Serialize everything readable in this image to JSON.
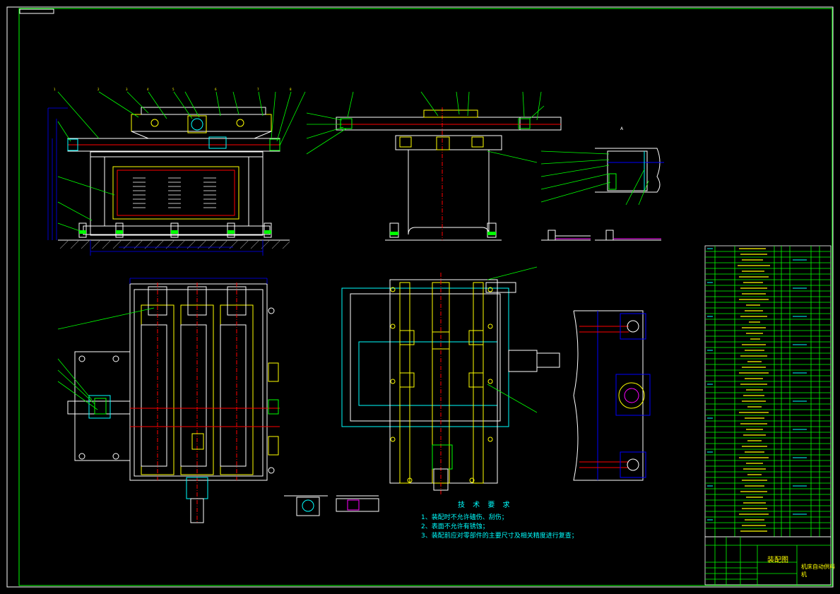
{
  "drawing": {
    "technical_requirements": {
      "title": "技 术 要 求",
      "lines": [
        "1、装配时不允许磕伤、刮伤；",
        "2、表面不允许有锈蚀；",
        "3、装配前应对零部件的主要尺寸及相关精度进行复查；"
      ]
    },
    "title_block": {
      "drawing_type": "装配图",
      "drawing_name": "机床自动供料机"
    },
    "colors": {
      "background": "#000000",
      "frame": "#00ff00",
      "outline": "#ffffff",
      "dimension": "#0000ff",
      "centerline": "#ff0000",
      "leader": "#00ff00",
      "part": "#ffff00",
      "cyan": "#00ffff",
      "magenta": "#ff00ff"
    }
  }
}
